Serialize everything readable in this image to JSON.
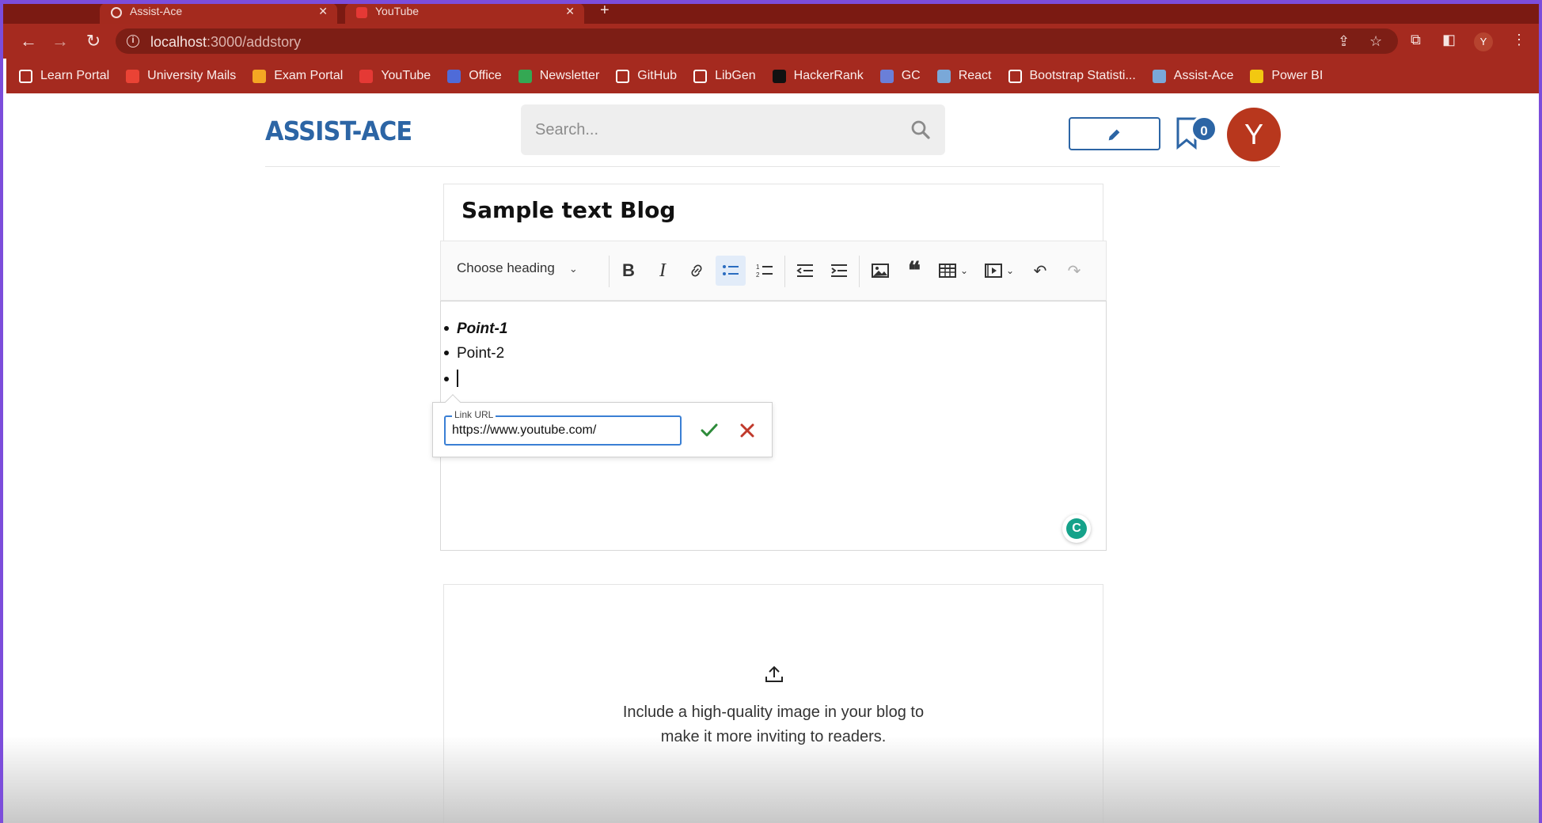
{
  "browser": {
    "tabs": [
      {
        "label": "Assist-Ace"
      },
      {
        "label": "YouTube"
      }
    ],
    "url_host": "localhost",
    "url_path": ":3000/addstory",
    "profile_initial": "Y",
    "bookmarks": [
      {
        "label": "Learn Portal",
        "icon": "learn-portal-icon",
        "color": "#ffffff"
      },
      {
        "label": "University Mails",
        "icon": "gmail-icon",
        "color": "#ea4335"
      },
      {
        "label": "Exam Portal",
        "icon": "exam-portal-icon",
        "color": "#f4a623"
      },
      {
        "label": "YouTube",
        "icon": "youtube-icon",
        "color": "#e53935"
      },
      {
        "label": "Office",
        "icon": "office-icon",
        "color": "#4f6bd8"
      },
      {
        "label": "Newsletter",
        "icon": "drive-icon",
        "color": "#34a853"
      },
      {
        "label": "GitHub",
        "icon": "github-icon",
        "color": "#ffffff"
      },
      {
        "label": "LibGen",
        "icon": "libgen-icon",
        "color": "#ffffff"
      },
      {
        "label": "HackerRank",
        "icon": "hackerrank-icon",
        "color": "#111111"
      },
      {
        "label": "GC",
        "icon": "gc-icon",
        "color": "#6a7fd8"
      },
      {
        "label": "React",
        "icon": "react-icon",
        "color": "#7aa8d8"
      },
      {
        "label": "Bootstrap Statisti...",
        "icon": "bootstrap-icon",
        "color": "#ffffff"
      },
      {
        "label": "Assist-Ace",
        "icon": "react-icon",
        "color": "#7aa8d8"
      },
      {
        "label": "Power BI",
        "icon": "powerbi-icon",
        "color": "#f2c811"
      }
    ]
  },
  "header": {
    "logo": "ASSIST-ACE",
    "search_placeholder": "Search...",
    "bookmark_count": "0",
    "avatar_initial": "Y"
  },
  "editor": {
    "title": "Sample text Blog",
    "heading_select": "Choose heading",
    "bullets": [
      "Point-1",
      "Point-2",
      ""
    ],
    "link_label": "Link URL",
    "link_value": "https://www.youtube.com/",
    "grammarly_letter": "C"
  },
  "upload": {
    "line1": "Include a high-quality image in your blog to",
    "line2": "make it more inviting to readers."
  },
  "colors": {
    "brand": "#2c65a5",
    "avatar": "#b8371d",
    "browser_toolbar": "#a52a1f",
    "confirm": "#2e8b3a",
    "cancel": "#c0392b"
  }
}
